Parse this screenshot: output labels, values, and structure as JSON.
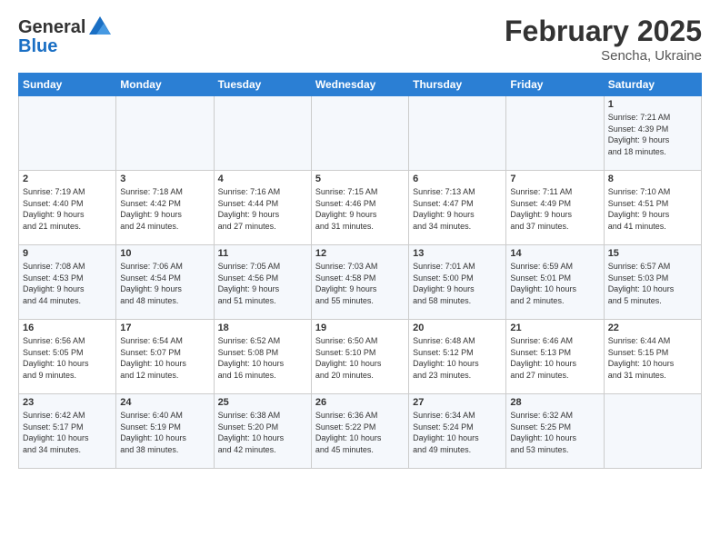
{
  "header": {
    "logo_line1": "General",
    "logo_line2": "Blue",
    "month_year": "February 2025",
    "location": "Sencha, Ukraine"
  },
  "weekdays": [
    "Sunday",
    "Monday",
    "Tuesday",
    "Wednesday",
    "Thursday",
    "Friday",
    "Saturday"
  ],
  "weeks": [
    [
      {
        "day": "",
        "info": ""
      },
      {
        "day": "",
        "info": ""
      },
      {
        "day": "",
        "info": ""
      },
      {
        "day": "",
        "info": ""
      },
      {
        "day": "",
        "info": ""
      },
      {
        "day": "",
        "info": ""
      },
      {
        "day": "1",
        "info": "Sunrise: 7:21 AM\nSunset: 4:39 PM\nDaylight: 9 hours\nand 18 minutes."
      }
    ],
    [
      {
        "day": "2",
        "info": "Sunrise: 7:19 AM\nSunset: 4:40 PM\nDaylight: 9 hours\nand 21 minutes."
      },
      {
        "day": "3",
        "info": "Sunrise: 7:18 AM\nSunset: 4:42 PM\nDaylight: 9 hours\nand 24 minutes."
      },
      {
        "day": "4",
        "info": "Sunrise: 7:16 AM\nSunset: 4:44 PM\nDaylight: 9 hours\nand 27 minutes."
      },
      {
        "day": "5",
        "info": "Sunrise: 7:15 AM\nSunset: 4:46 PM\nDaylight: 9 hours\nand 31 minutes."
      },
      {
        "day": "6",
        "info": "Sunrise: 7:13 AM\nSunset: 4:47 PM\nDaylight: 9 hours\nand 34 minutes."
      },
      {
        "day": "7",
        "info": "Sunrise: 7:11 AM\nSunset: 4:49 PM\nDaylight: 9 hours\nand 37 minutes."
      },
      {
        "day": "8",
        "info": "Sunrise: 7:10 AM\nSunset: 4:51 PM\nDaylight: 9 hours\nand 41 minutes."
      }
    ],
    [
      {
        "day": "9",
        "info": "Sunrise: 7:08 AM\nSunset: 4:53 PM\nDaylight: 9 hours\nand 44 minutes."
      },
      {
        "day": "10",
        "info": "Sunrise: 7:06 AM\nSunset: 4:54 PM\nDaylight: 9 hours\nand 48 minutes."
      },
      {
        "day": "11",
        "info": "Sunrise: 7:05 AM\nSunset: 4:56 PM\nDaylight: 9 hours\nand 51 minutes."
      },
      {
        "day": "12",
        "info": "Sunrise: 7:03 AM\nSunset: 4:58 PM\nDaylight: 9 hours\nand 55 minutes."
      },
      {
        "day": "13",
        "info": "Sunrise: 7:01 AM\nSunset: 5:00 PM\nDaylight: 9 hours\nand 58 minutes."
      },
      {
        "day": "14",
        "info": "Sunrise: 6:59 AM\nSunset: 5:01 PM\nDaylight: 10 hours\nand 2 minutes."
      },
      {
        "day": "15",
        "info": "Sunrise: 6:57 AM\nSunset: 5:03 PM\nDaylight: 10 hours\nand 5 minutes."
      }
    ],
    [
      {
        "day": "16",
        "info": "Sunrise: 6:56 AM\nSunset: 5:05 PM\nDaylight: 10 hours\nand 9 minutes."
      },
      {
        "day": "17",
        "info": "Sunrise: 6:54 AM\nSunset: 5:07 PM\nDaylight: 10 hours\nand 12 minutes."
      },
      {
        "day": "18",
        "info": "Sunrise: 6:52 AM\nSunset: 5:08 PM\nDaylight: 10 hours\nand 16 minutes."
      },
      {
        "day": "19",
        "info": "Sunrise: 6:50 AM\nSunset: 5:10 PM\nDaylight: 10 hours\nand 20 minutes."
      },
      {
        "day": "20",
        "info": "Sunrise: 6:48 AM\nSunset: 5:12 PM\nDaylight: 10 hours\nand 23 minutes."
      },
      {
        "day": "21",
        "info": "Sunrise: 6:46 AM\nSunset: 5:13 PM\nDaylight: 10 hours\nand 27 minutes."
      },
      {
        "day": "22",
        "info": "Sunrise: 6:44 AM\nSunset: 5:15 PM\nDaylight: 10 hours\nand 31 minutes."
      }
    ],
    [
      {
        "day": "23",
        "info": "Sunrise: 6:42 AM\nSunset: 5:17 PM\nDaylight: 10 hours\nand 34 minutes."
      },
      {
        "day": "24",
        "info": "Sunrise: 6:40 AM\nSunset: 5:19 PM\nDaylight: 10 hours\nand 38 minutes."
      },
      {
        "day": "25",
        "info": "Sunrise: 6:38 AM\nSunset: 5:20 PM\nDaylight: 10 hours\nand 42 minutes."
      },
      {
        "day": "26",
        "info": "Sunrise: 6:36 AM\nSunset: 5:22 PM\nDaylight: 10 hours\nand 45 minutes."
      },
      {
        "day": "27",
        "info": "Sunrise: 6:34 AM\nSunset: 5:24 PM\nDaylight: 10 hours\nand 49 minutes."
      },
      {
        "day": "28",
        "info": "Sunrise: 6:32 AM\nSunset: 5:25 PM\nDaylight: 10 hours\nand 53 minutes."
      },
      {
        "day": "",
        "info": ""
      }
    ]
  ]
}
